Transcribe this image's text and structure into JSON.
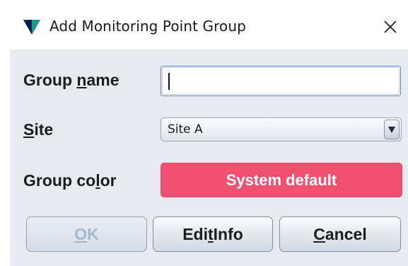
{
  "dialog": {
    "title": "Add Monitoring Point Group",
    "close_icon": "close-icon",
    "app_icon": "triangle-logo-icon"
  },
  "form": {
    "group_name": {
      "label_pre": "Group ",
      "label_mnemonic": "n",
      "label_post": "ame",
      "value": "",
      "placeholder": ""
    },
    "site": {
      "label_pre": "",
      "label_mnemonic": "S",
      "label_post": "ite",
      "selected": "Site A",
      "dropdown_icon": "triangle-down-icon"
    },
    "group_color": {
      "label_pre": "Group co",
      "label_mnemonic": "l",
      "label_post": "or",
      "button_label": "System default",
      "color": "#f05070"
    }
  },
  "buttons": {
    "ok": {
      "pre": "",
      "mnemonic": "O",
      "post": "K",
      "enabled": false
    },
    "edit_info": {
      "pre": "Edi",
      "mnemonic": "t",
      "post": " Info",
      "enabled": true
    },
    "cancel": {
      "pre": "",
      "mnemonic": "C",
      "post": "ancel",
      "enabled": true
    }
  },
  "colors": {
    "panel_bg": "#e7ebf0",
    "accent_blue": "#5f87c2",
    "logo_dark": "#0d1a5a",
    "logo_teal": "#1a9a88"
  }
}
